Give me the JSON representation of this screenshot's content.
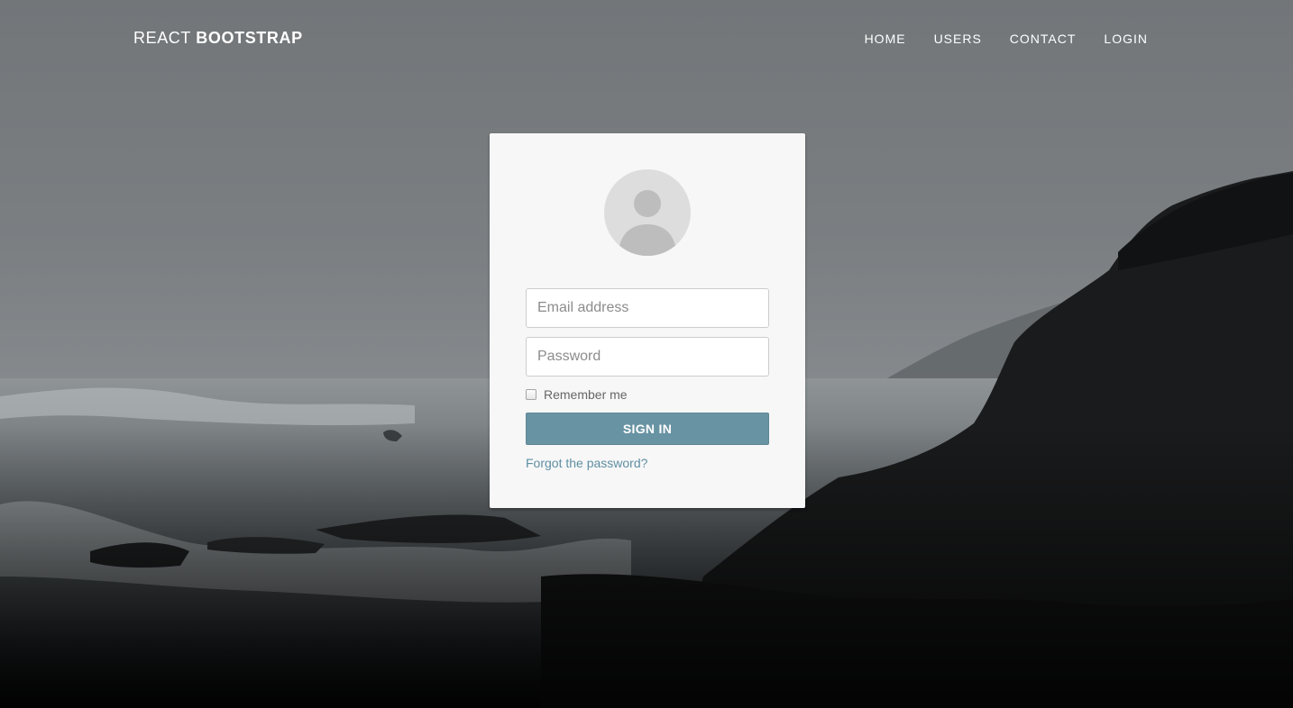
{
  "navbar": {
    "brand_light": "REACT",
    "brand_bold": "BOOTSTRAP",
    "links": [
      "HOME",
      "USERS",
      "CONTACT",
      "LOGIN"
    ]
  },
  "login": {
    "email_placeholder": "Email address",
    "email_value": "",
    "password_placeholder": "Password",
    "password_value": "",
    "remember_label": "Remember me",
    "remember_checked": false,
    "submit_label": "SIGN IN",
    "forgot_label": "Forgot the password?",
    "accent_color": "#6893a3",
    "link_color": "#5f8fa3"
  },
  "icons": {
    "avatar": "user-avatar-icon"
  }
}
